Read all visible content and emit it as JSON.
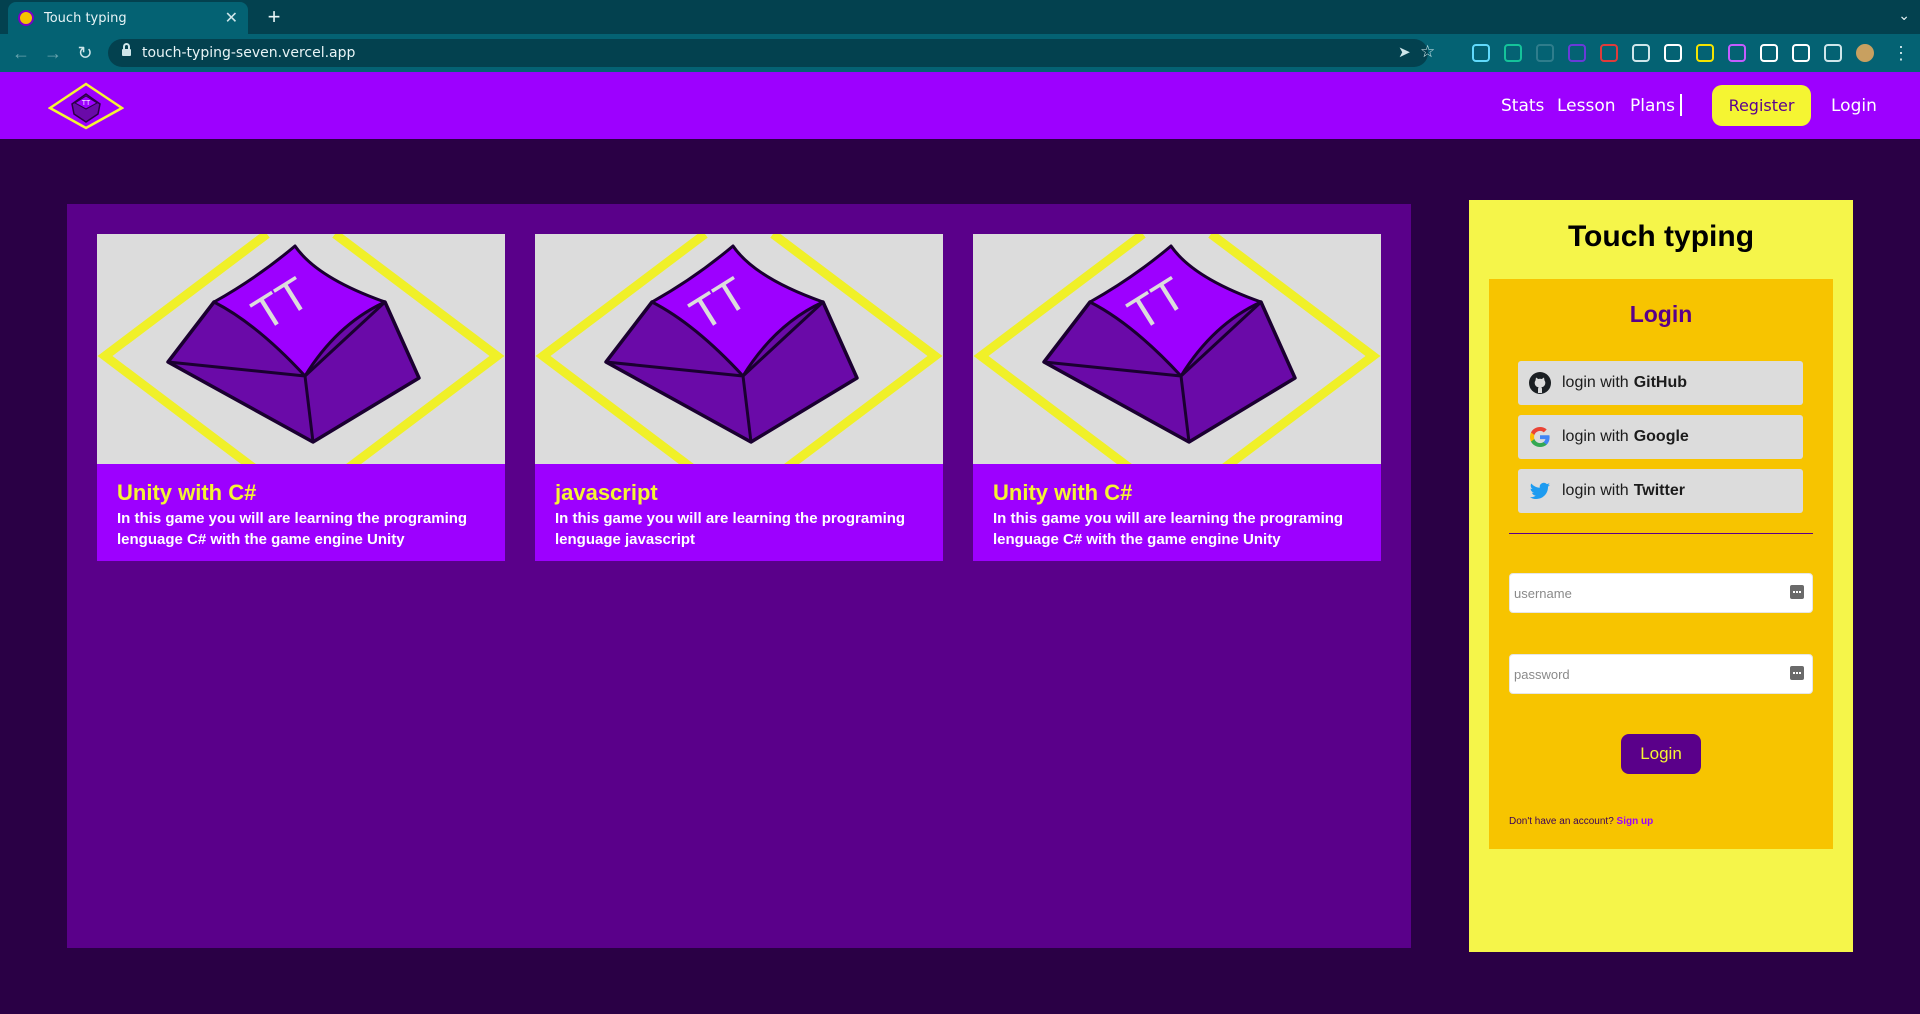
{
  "browser": {
    "tab_title": "Touch typing",
    "tab_close": "✕",
    "new_tab": "+",
    "tab_menu": "⌄",
    "url": "touch-typing-seven.vercel.app",
    "back": "←",
    "forward": "→",
    "reload": "↻",
    "send_icon": "➤",
    "star_icon": "☆",
    "menu_icon": "⋮",
    "extensions": [
      {
        "name": "react-devtools-icon",
        "color": "#61dafb"
      },
      {
        "name": "grammarly-icon",
        "color": "#15c39a"
      },
      {
        "name": "json-viewer-icon",
        "color": "#2f7d8c"
      },
      {
        "name": "extension-badge-icon",
        "color": "#6a3ad8"
      },
      {
        "name": "extension-red-icon",
        "color": "#e03b3b"
      },
      {
        "name": "font-icon",
        "color": "#cfe6ea"
      },
      {
        "name": "cloud-icon",
        "color": "#ffffff"
      },
      {
        "name": "yellow-extension-icon",
        "color": "#f5e400"
      },
      {
        "name": "color-picker-icon",
        "color": "#c45cff"
      },
      {
        "name": "notion-icon",
        "color": "#ffffff"
      },
      {
        "name": "checkbox-extension-icon",
        "color": "#ffffff"
      },
      {
        "name": "puzzle-icon",
        "color": "#cfe6ea"
      },
      {
        "name": "profile-avatar-icon",
        "color": "#c8a060"
      }
    ]
  },
  "navbar": {
    "links": [
      "Stats",
      "Lesson",
      "Plans"
    ],
    "register": "Register",
    "login": "Login"
  },
  "cards": [
    {
      "title": "Unity with C#",
      "description": "In this game you will are learning the programing lenguage C# with the game engine Unity"
    },
    {
      "title": "javascript",
      "description": "In this game you will are learning the programing lenguage javascript"
    },
    {
      "title": "Unity with C#",
      "description": "In this game you will are learning the programing lenguage C# with the game engine Unity"
    }
  ],
  "logo_text": "TT",
  "aside": {
    "title": "Touch typing",
    "login_heading": "Login",
    "oauth": [
      {
        "prefix": "login with",
        "provider": "GitHub"
      },
      {
        "prefix": "login with",
        "provider": "Google"
      },
      {
        "prefix": "login with",
        "provider": "Twitter"
      }
    ],
    "username_placeholder": "username",
    "password_placeholder": "password",
    "login_button": "Login",
    "signup_prompt": "Don't have an account?",
    "signup_link": "Sign up"
  },
  "colors": {
    "brand_purple": "#9d00ff",
    "panel_purple": "#5a008a",
    "background": "#2a0045",
    "accent_yellow": "#f5f532",
    "login_box": "#f7c400"
  }
}
